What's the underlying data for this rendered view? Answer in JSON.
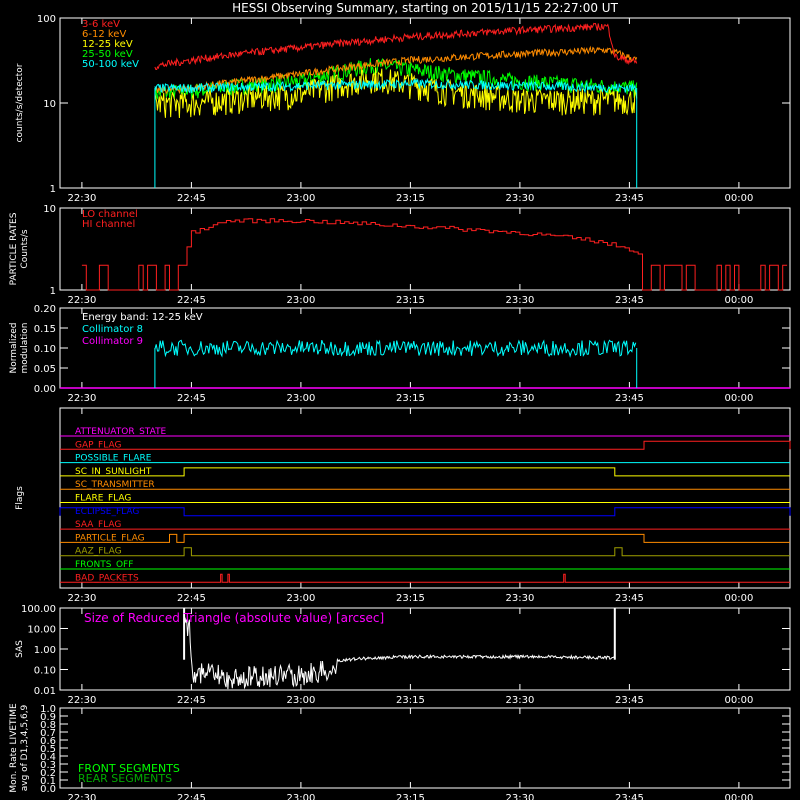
{
  "title": "HESSI Observing Summary, starting on 2015/11/15 22:27:00 UT",
  "time_ticks": [
    "22:30",
    "22:45",
    "23:00",
    "23:15",
    "23:30",
    "23:45",
    "00:00"
  ],
  "colors": {
    "red": "#ff2020",
    "orange": "#ff8c00",
    "yellow": "#ffff00",
    "green": "#00ff00",
    "cyan": "#00ffff",
    "magenta": "#ff00ff",
    "white": "#ffffff",
    "olive": "#a0a000",
    "blue": "#0000ff",
    "pink": "#ff66cc",
    "darkgreen": "#00aa00"
  },
  "chart_data": [
    {
      "id": "rates",
      "type": "line",
      "ylabel": "counts/s/detector",
      "y_scale": "log",
      "ylim": [
        1,
        100
      ],
      "y_ticks": [
        "1",
        "10",
        "100"
      ],
      "xlim": [
        "22:27",
        "00:07"
      ],
      "series": [
        {
          "name": "3-6 keV",
          "color": "#ff2020",
          "x": [
            "22:40",
            "22:45",
            "23:00",
            "23:15",
            "23:30",
            "23:42",
            "23:43",
            "23:46"
          ],
          "y": [
            27,
            32,
            45,
            60,
            72,
            80,
            35,
            30
          ]
        },
        {
          "name": "6-12 keV",
          "color": "#ff8c00",
          "x": [
            "22:40",
            "22:45",
            "23:00",
            "23:15",
            "23:30",
            "23:42",
            "23:46"
          ],
          "y": [
            14,
            15,
            22,
            32,
            38,
            42,
            32
          ]
        },
        {
          "name": "12-25 keV",
          "color": "#ffff00",
          "x": [
            "22:40",
            "22:45",
            "23:00",
            "23:10",
            "23:20",
            "23:30",
            "23:46"
          ],
          "y": [
            10,
            10,
            13,
            20,
            14,
            11,
            11
          ]
        },
        {
          "name": "25-50 keV",
          "color": "#00ff00",
          "x": [
            "22:40",
            "22:45",
            "23:00",
            "23:10",
            "23:20",
            "23:30",
            "23:46"
          ],
          "y": [
            13,
            14,
            18,
            28,
            22,
            18,
            15
          ]
        },
        {
          "name": "50-100 keV",
          "color": "#00ffff",
          "x": [
            "22:40",
            "22:45",
            "23:00",
            "23:15",
            "23:30",
            "23:46"
          ],
          "y": [
            15,
            15,
            16,
            17,
            16,
            15
          ]
        }
      ]
    },
    {
      "id": "particle",
      "type": "line",
      "ylabel": "PARTICLE RATES",
      "ylabel2": "Counts/s",
      "y_scale": "log",
      "ylim": [
        1,
        10
      ],
      "y_ticks": [
        "1",
        "10"
      ],
      "series": [
        {
          "name": "LO channel",
          "color": "#ff2020",
          "x": [
            "22:30",
            "22:44",
            "22:45",
            "22:50",
            "23:00",
            "23:15",
            "23:30",
            "23:40",
            "23:46",
            "23:47",
            "00:07"
          ],
          "y": [
            1.7,
            2,
            5,
            7,
            7,
            6,
            5,
            4,
            3,
            1.5,
            1.7
          ]
        },
        {
          "name": "HI channel",
          "color": "#ff2020",
          "x": [],
          "y": []
        }
      ]
    },
    {
      "id": "modulation",
      "type": "line",
      "ylabel": "Normalized",
      "ylabel2": "modulation",
      "ylim": [
        0,
        0.2
      ],
      "y_ticks": [
        "0.00",
        "0.05",
        "0.10",
        "0.15",
        "0.20"
      ],
      "annotation": "Energy band: 12-25 keV",
      "series": [
        {
          "name": "Collimator 8",
          "color": "#00ffff",
          "x": [
            "22:40",
            "23:46"
          ],
          "y": [
            0.1,
            0.1
          ]
        },
        {
          "name": "Collimator 9",
          "color": "#ff00ff",
          "x": [
            "22:27",
            "00:07"
          ],
          "y": [
            0,
            0
          ]
        }
      ]
    },
    {
      "id": "flags",
      "type": "table",
      "ylabel": "Flags",
      "rows": [
        {
          "name": "ATTENUATOR_STATE",
          "color": "#ff00ff",
          "high": []
        },
        {
          "name": "GAP_FLAG",
          "color": "#ff2020",
          "high": [
            [
              "23:47",
              "00:07"
            ]
          ]
        },
        {
          "name": "POSSIBLE_FLARE",
          "color": "#00ffff",
          "high": []
        },
        {
          "name": "SC_IN_SUNLIGHT",
          "color": "#ffff00",
          "high": [
            [
              "22:44",
              "23:43"
            ]
          ]
        },
        {
          "name": "SC_TRANSMITTER",
          "color": "#ff8c00",
          "high": []
        },
        {
          "name": "FLARE_FLAG",
          "color": "#ffff00",
          "high": []
        },
        {
          "name": "ECLIPSE_FLAG",
          "color": "#0000ff",
          "high": [
            [
              "22:27",
              "22:44"
            ],
            [
              "23:43",
              "00:07"
            ]
          ]
        },
        {
          "name": "SAA_FLAG",
          "color": "#ff2020",
          "high": []
        },
        {
          "name": "PARTICLE_FLAG",
          "color": "#ff8c00",
          "high": [
            [
              "22:42",
              "22:43"
            ],
            [
              "22:44",
              "23:47"
            ]
          ]
        },
        {
          "name": "AAZ_FLAG",
          "color": "#a0a000",
          "high": [
            [
              "22:44",
              "22:45"
            ],
            [
              "23:43",
              "23:44"
            ]
          ]
        },
        {
          "name": "FRONTS_OFF",
          "color": "#00ff00",
          "high": []
        },
        {
          "name": "BAD_PACKETS",
          "color": "#ff2020",
          "high": [
            [
              "22:49",
              "22:49"
            ],
            [
              "22:50",
              "22:50"
            ],
            [
              "23:36",
              "23:36"
            ]
          ]
        }
      ]
    },
    {
      "id": "sas",
      "type": "line",
      "ylabel": "SAS",
      "y_scale": "log",
      "ylim": [
        0.01,
        100
      ],
      "y_ticks": [
        "0.01",
        "0.10",
        "1.00",
        "10.00",
        "100.00"
      ],
      "annotation": "Size of Reduced Triangle (absolute value) [arcsec]",
      "series": [
        {
          "name": "SAS",
          "color": "#ffffff",
          "x": [
            "22:44",
            "22:45",
            "22:50",
            "23:00",
            "23:08",
            "23:15",
            "23:30",
            "23:43"
          ],
          "y": [
            100,
            0.3,
            0.12,
            0.2,
            0.4,
            0.5,
            0.5,
            0.45
          ]
        }
      ]
    },
    {
      "id": "livetime",
      "type": "line",
      "ylabel": "Mon. Rate LIVETIME",
      "ylabel2": "avg of D1,3,4,5,6,9",
      "ylim": [
        0,
        1
      ],
      "y_ticks": [
        "0.0",
        "0.1",
        "0.2",
        "0.3",
        "0.4",
        "0.5",
        "0.6",
        "0.7",
        "0.8",
        "0.9",
        "1.0"
      ],
      "series": [
        {
          "name": "FRONT SEGMENTS",
          "color": "#00ff00",
          "x": [],
          "y": []
        },
        {
          "name": "REAR SEGMENTS",
          "color": "#00aa00",
          "x": [],
          "y": []
        }
      ]
    }
  ]
}
